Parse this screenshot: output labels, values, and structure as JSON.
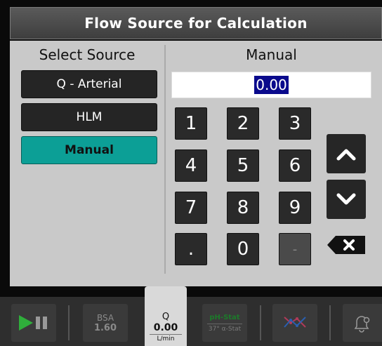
{
  "title": "Flow Source for Calculation",
  "left": {
    "heading": "Select Source",
    "sources": [
      "Q - Arterial",
      "HLM",
      "Manual"
    ],
    "selected": "Manual"
  },
  "right": {
    "heading": "Manual",
    "value": "0.00",
    "keys": [
      "1",
      "2",
      "3",
      "4",
      "5",
      "6",
      "7",
      "8",
      "9",
      ".",
      "0",
      "-"
    ]
  },
  "toolbar": {
    "bsa_label": "BSA",
    "bsa_value": "1.60",
    "q_label": "Q",
    "q_value": "0.00",
    "q_unit": "L/min",
    "phstat_label": "pH-Stat",
    "phstat_sub": "37° α-Stat"
  },
  "colors": {
    "accent": "#0c9f96",
    "play": "#2fae3b",
    "value_highlight": "#0a0a8c"
  }
}
